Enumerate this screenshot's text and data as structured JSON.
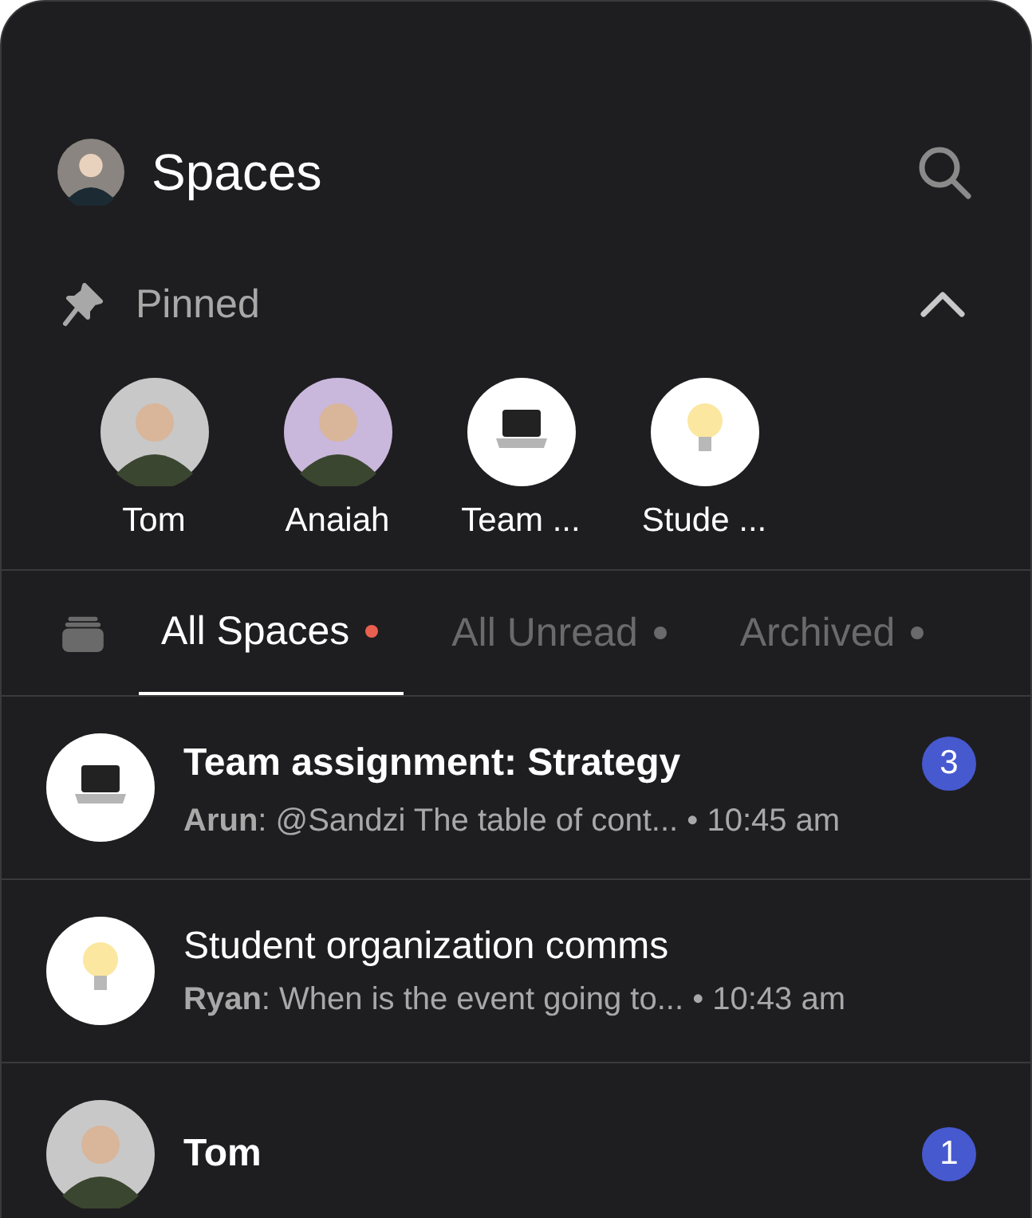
{
  "header": {
    "title": "Spaces",
    "avatar": {
      "kind": "person",
      "color": "#8a8580"
    }
  },
  "pinned": {
    "label": "Pinned",
    "expanded": true,
    "items": [
      {
        "label": "Tom",
        "kind": "person",
        "color": "#c8c8c8"
      },
      {
        "label": "Anaiah",
        "kind": "person",
        "color": "#c9b8dc"
      },
      {
        "label": "Team ...",
        "kind": "laptop"
      },
      {
        "label": "Stude ...",
        "kind": "bulb"
      }
    ]
  },
  "tabs": [
    {
      "label": "All Spaces",
      "selected": true
    },
    {
      "label": "All Unread",
      "selected": false
    },
    {
      "label": "Archived",
      "selected": false
    }
  ],
  "spaces": [
    {
      "title": "Team assignment: Strategy",
      "unread": true,
      "badge": "3",
      "kind": "laptop",
      "preview": "**Arun**: @Sandzi The table of cont... • 10:45 am"
    },
    {
      "title": "Student organization comms",
      "unread": false,
      "kind": "bulb",
      "preview": "**Ryan**: When is the event going to... • 10:43 am"
    },
    {
      "title": "Tom",
      "unread": true,
      "badge": "1",
      "kind": "person",
      "color": "#c8c8c8"
    }
  ]
}
